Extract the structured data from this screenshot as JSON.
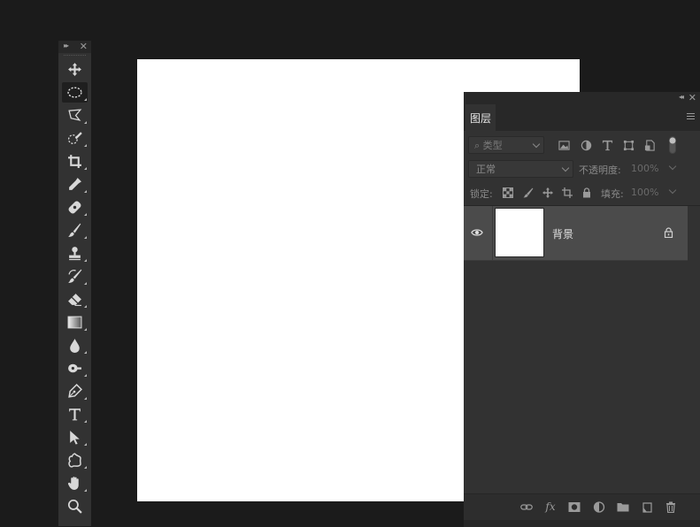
{
  "toolbar": {
    "collapse_glyph": "▸▸",
    "close_glyph": "✕",
    "tools": [
      {
        "name": "move-tool",
        "icon": "move-icon",
        "active": false
      },
      {
        "name": "elliptical-marquee-tool",
        "icon": "ellipse-marquee-icon",
        "active": true
      },
      {
        "name": "polygonal-lasso-tool",
        "icon": "polygonal-lasso-icon",
        "active": false
      },
      {
        "name": "quick-selection-tool",
        "icon": "quick-selection-icon",
        "active": false
      },
      {
        "name": "crop-tool",
        "icon": "crop-icon",
        "active": false
      },
      {
        "name": "eyedropper-tool",
        "icon": "eyedropper-icon",
        "active": false
      },
      {
        "name": "healing-brush-tool",
        "icon": "bandage-icon",
        "active": false
      },
      {
        "name": "brush-tool",
        "icon": "brush-icon",
        "active": false
      },
      {
        "name": "clone-stamp-tool",
        "icon": "stamp-icon",
        "active": false
      },
      {
        "name": "history-brush-tool",
        "icon": "history-brush-icon",
        "active": false
      },
      {
        "name": "eraser-tool",
        "icon": "eraser-icon",
        "active": false
      },
      {
        "name": "gradient-tool",
        "icon": "gradient-icon",
        "active": false
      },
      {
        "name": "blur-tool",
        "icon": "droplet-icon",
        "active": false
      },
      {
        "name": "dodge-tool",
        "icon": "dodge-icon",
        "active": false
      },
      {
        "name": "pen-tool",
        "icon": "pen-icon",
        "active": false
      },
      {
        "name": "type-tool",
        "icon": "type-icon",
        "active": false
      },
      {
        "name": "path-selection-tool",
        "icon": "arrow-cursor-icon",
        "active": false
      },
      {
        "name": "custom-shape-tool",
        "icon": "custom-shape-icon",
        "active": false
      },
      {
        "name": "hand-tool",
        "icon": "hand-icon",
        "active": false
      },
      {
        "name": "zoom-tool",
        "icon": "magnifier-icon",
        "active": false
      }
    ]
  },
  "layers_panel": {
    "collapse_glyph": "◂◂",
    "close_glyph": "✕",
    "tab_label": "图层",
    "filter": {
      "kind_label": "⌕ 类型"
    },
    "blend_mode": "正常",
    "opacity_label": "不透明度:",
    "opacity_value": "100%",
    "lock_label": "锁定:",
    "fill_label": "填充:",
    "fill_value": "100%",
    "layers": [
      {
        "name": "背景",
        "visible": true,
        "locked": true
      }
    ],
    "footer_fx": "fx"
  },
  "colors": {
    "app_bg": "#1b1b1b",
    "panel_bg": "#323232",
    "selected_layer": "#4b4b4b",
    "canvas": "#ffffff"
  }
}
